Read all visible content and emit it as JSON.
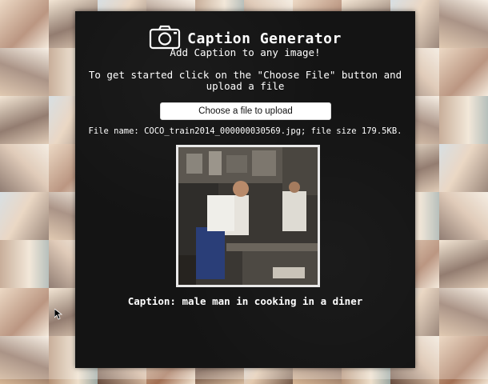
{
  "app": {
    "title": "Caption Generator",
    "subtitle": "Add Caption to any image!",
    "instructions": "To get started click on the \"Choose File\" button and upload a file"
  },
  "upload": {
    "button_label": "Choose a file to upload"
  },
  "file": {
    "info": "File name: COCO_train2014_000000030569.jpg; file size 179.5KB."
  },
  "result": {
    "caption": "Caption: male man in cooking in a diner"
  },
  "icons": {
    "header": "camera-icon",
    "pointer": "cursor-icon"
  },
  "colors": {
    "panel": "#141414",
    "text": "#ffffff",
    "button": "#ffffff"
  }
}
